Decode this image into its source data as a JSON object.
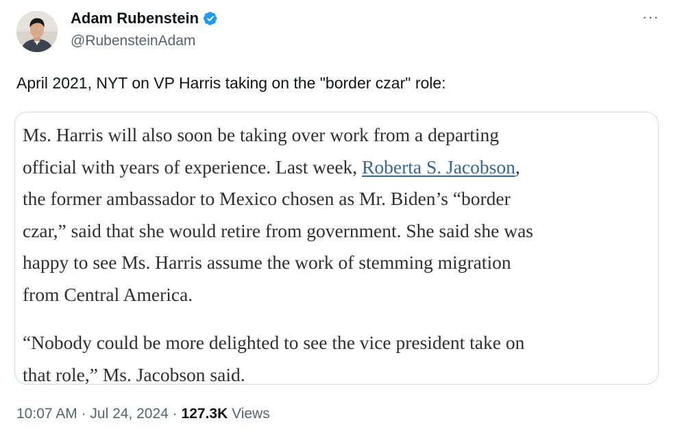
{
  "author": {
    "display_name": "Adam Rubenstein",
    "handle": "@RubensteinAdam",
    "verified": true,
    "avatar_icon": "profile-photo"
  },
  "more_icon": "ellipsis-icon",
  "more_glyph": "···",
  "tweet_text": "April 2021, NYT on VP Harris taking on the \"border czar\" role:",
  "quote": {
    "lines": [
      "Ms. Harris will also soon be taking over work from a departing",
      "official with years of experience. Last week, ",
      "the former ambassador to Mexico chosen as Mr. Biden’s “border",
      "czar,” said that she would retire from government. She said she was",
      "happy to see Ms. Harris assume the work of stemming migration",
      "from Central America."
    ],
    "link_text": "Roberta S. Jacobson",
    "link_suffix": ",",
    "para2_lines": [
      "“Nobody could be more delighted to see the vice president take on",
      "that role,” Ms. Jacobson said."
    ]
  },
  "meta": {
    "time": "10:07 AM",
    "separator": " · ",
    "date": "Jul 24, 2024",
    "views_count": "127.3K",
    "views_label": " Views"
  },
  "colors": {
    "verified_badge": "#1d9bf0",
    "link": "#326891",
    "secondary_text": "#536471",
    "border": "#cfd9de"
  }
}
